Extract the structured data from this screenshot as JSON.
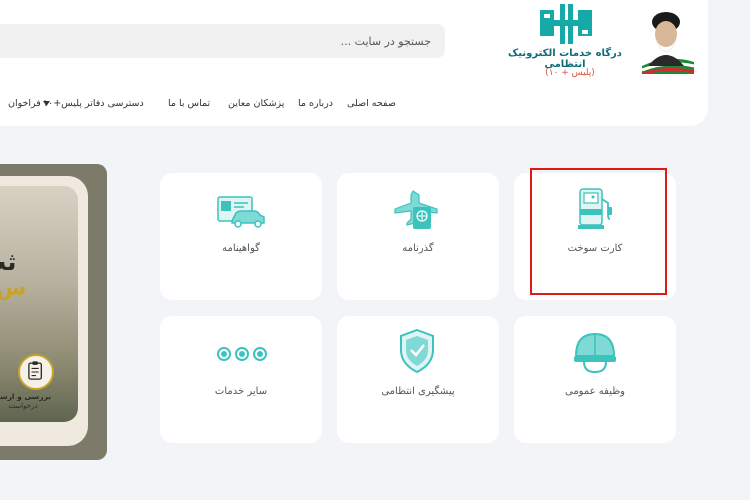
{
  "search": {
    "placeholder": "جستجو در سایت ..."
  },
  "logo": {
    "title": "درگاه خدمات الکترونیک انتظامی",
    "subtitle": "(پلیس + ۱۰)"
  },
  "nav": {
    "home": "صفحه اصلی",
    "about": "درباره ما",
    "doctors": "پزشکان معاین",
    "contact": "تماس با ما",
    "offices": "دسترسی دفاتر پلیس+۱۰",
    "calls": "فراخوان"
  },
  "services": {
    "fuel_card": "کارت سوخت",
    "passport": "گذرنامه",
    "license": "گواهینامه",
    "military": "وظیفه عمومی",
    "prevention": "پیشگیری انتظامی",
    "other": "سایر خدمات"
  },
  "banner": {
    "headline1": "ثب",
    "headline2": "س",
    "step_title": "بررسی و ارسال",
    "step_sub": "درخواست"
  },
  "colors": {
    "accent": "#3cc3bd",
    "accent_dark": "#0f6d7a",
    "highlight": "#e01919"
  }
}
